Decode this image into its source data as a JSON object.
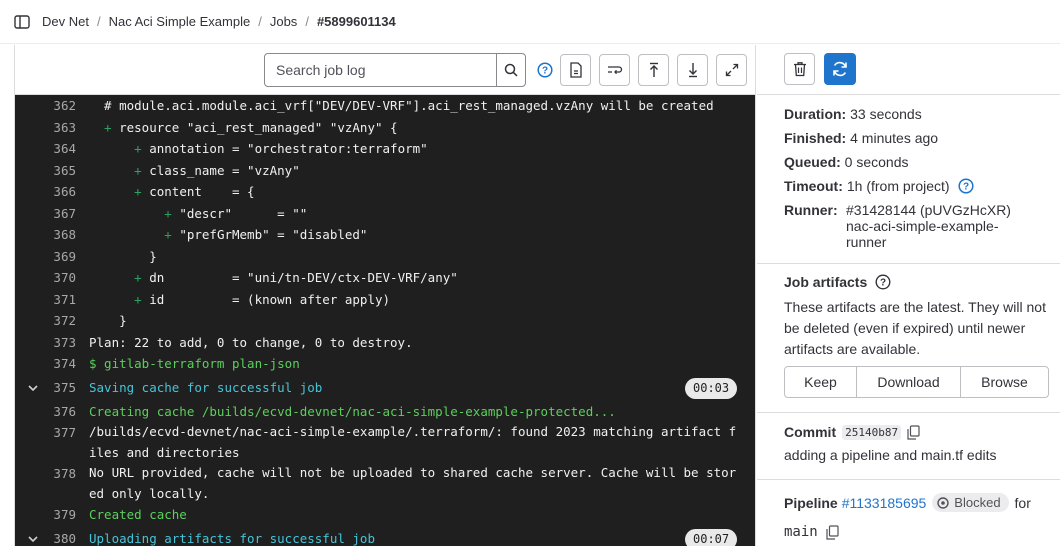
{
  "breadcrumb": {
    "items": [
      "Dev Net",
      "Nac Aci Simple Example",
      "Jobs"
    ],
    "current": "#5899601134",
    "separator": "/"
  },
  "toolbar": {
    "search_placeholder": "Search job log"
  },
  "log_lines": [
    {
      "num": "362",
      "parts": [
        {
          "t": "  # module.aci.module.aci_vrf[\"DEV/DEV-VRF\"].aci_rest_managed.vzAny will be created",
          "c": ""
        }
      ]
    },
    {
      "num": "363",
      "parts": [
        {
          "t": "  + ",
          "c": "plus"
        },
        {
          "t": "resource \"aci_rest_managed\" \"vzAny\" {",
          "c": ""
        }
      ]
    },
    {
      "num": "364",
      "parts": [
        {
          "t": "      + ",
          "c": "plus"
        },
        {
          "t": "annotation = \"orchestrator:terraform\"",
          "c": ""
        }
      ]
    },
    {
      "num": "365",
      "parts": [
        {
          "t": "      + ",
          "c": "plus"
        },
        {
          "t": "class_name = \"vzAny\"",
          "c": ""
        }
      ]
    },
    {
      "num": "366",
      "parts": [
        {
          "t": "      + ",
          "c": "plus"
        },
        {
          "t": "content    = {",
          "c": ""
        }
      ]
    },
    {
      "num": "367",
      "parts": [
        {
          "t": "          + ",
          "c": "plus"
        },
        {
          "t": "\"descr\"      = \"\"",
          "c": ""
        }
      ]
    },
    {
      "num": "368",
      "parts": [
        {
          "t": "          + ",
          "c": "plus"
        },
        {
          "t": "\"prefGrMemb\" = \"disabled\"",
          "c": ""
        }
      ]
    },
    {
      "num": "369",
      "parts": [
        {
          "t": "        }",
          "c": ""
        }
      ]
    },
    {
      "num": "370",
      "parts": [
        {
          "t": "      + ",
          "c": "plus"
        },
        {
          "t": "dn         = \"uni/tn-DEV/ctx-DEV-VRF/any\"",
          "c": ""
        }
      ]
    },
    {
      "num": "371",
      "parts": [
        {
          "t": "      + ",
          "c": "plus"
        },
        {
          "t": "id         = (known after apply)",
          "c": ""
        }
      ]
    },
    {
      "num": "372",
      "parts": [
        {
          "t": "    }",
          "c": ""
        }
      ]
    },
    {
      "num": "373",
      "parts": [
        {
          "t": "Plan: 22 to add, 0 to change, 0 to destroy.",
          "c": ""
        }
      ]
    },
    {
      "num": "374",
      "parts": [
        {
          "t": "$ gitlab-terraform plan-json",
          "c": "green"
        }
      ]
    },
    {
      "num": "375",
      "section": true,
      "badge": "00:03",
      "parts": [
        {
          "t": "Saving cache for successful job",
          "c": "cyan"
        }
      ]
    },
    {
      "num": "376",
      "parts": [
        {
          "t": "Creating cache /builds/ecvd-devnet/nac-aci-simple-example-protected...",
          "c": "green"
        }
      ]
    },
    {
      "num": "377",
      "wrap": true,
      "parts": [
        {
          "t": "/builds/ecvd-devnet/nac-aci-simple-example/.terraform/: found 2023 matching artifact files and directories",
          "c": ""
        }
      ]
    },
    {
      "num": "378",
      "wrap": true,
      "parts": [
        {
          "t": "No URL provided, cache will not be uploaded to shared cache server. Cache will be stored only locally.",
          "c": ""
        }
      ]
    },
    {
      "num": "379",
      "parts": [
        {
          "t": "Created cache",
          "c": "green"
        }
      ]
    },
    {
      "num": "380",
      "section": true,
      "badge": "00:07",
      "parts": [
        {
          "t": "Uploading artifacts for successful job",
          "c": "cyan"
        }
      ]
    }
  ],
  "sidebar": {
    "duration_label": "Duration:",
    "duration": "33 seconds",
    "finished_label": "Finished:",
    "finished": "4 minutes ago",
    "queued_label": "Queued:",
    "queued": "0 seconds",
    "timeout_label": "Timeout:",
    "timeout": "1h (from project)",
    "runner_label": "Runner:",
    "runner": "#31428144 (pUVGzHcXR) nac-aci-simple-example-runner",
    "artifacts_title": "Job artifacts",
    "artifacts_desc": "These artifacts are the latest. They will not be deleted (even if expired) until newer artifacts are available.",
    "keep_label": "Keep",
    "download_label": "Download",
    "browse_label": "Browse",
    "commit_label": "Commit",
    "commit_sha": "25140b87",
    "commit_msg": "adding a pipeline and main.tf edits",
    "pipeline_label": "Pipeline",
    "pipeline_id": "#1133185695",
    "pipeline_status": "Blocked",
    "for_label": "for",
    "ref": "main"
  },
  "colors": {
    "accent": "#1f75cb",
    "log_bg": "#1f1f1f",
    "log_green": "#5bd05b",
    "log_cyan": "#46c4d8"
  }
}
